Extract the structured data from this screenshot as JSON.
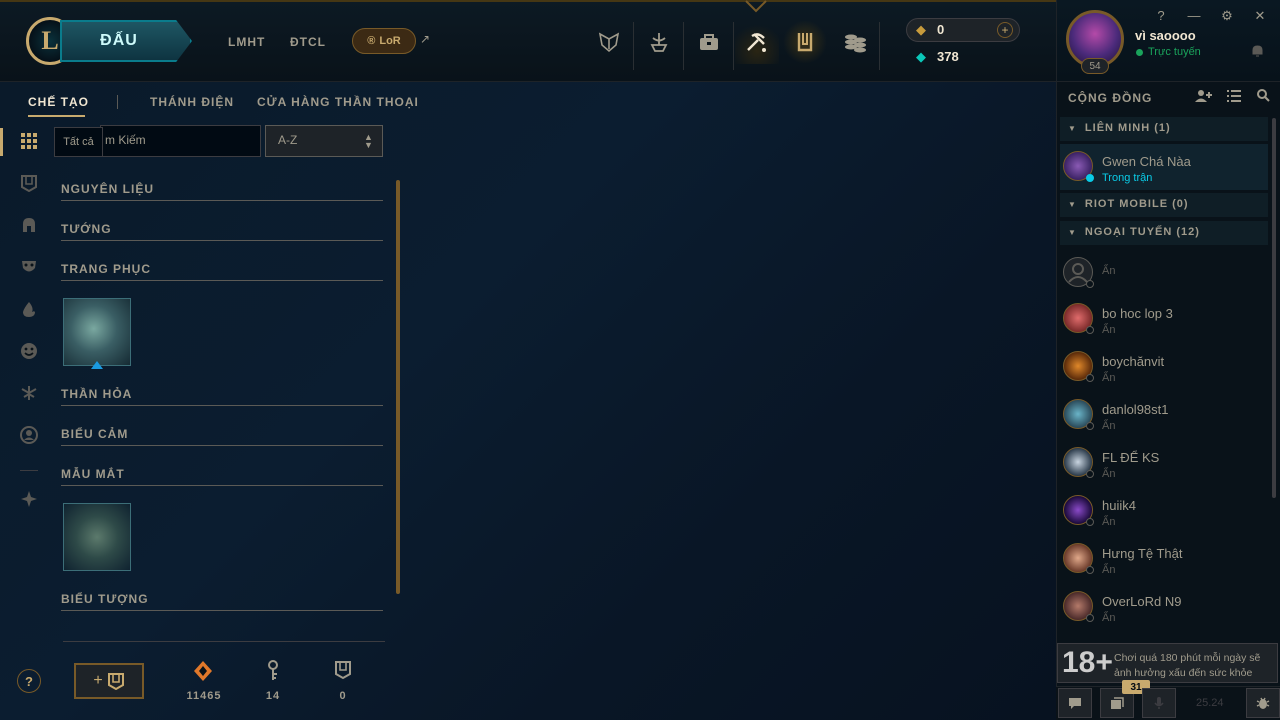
{
  "topbar": {
    "logo_letter": "L",
    "play_label": "ĐẤU",
    "nav_links": [
      "LMHT",
      "ĐTCL"
    ],
    "lor_label": "LoR",
    "ext_arrow": "↗",
    "icons": [
      "clash-icon",
      "ranked-icon",
      "collection-icon",
      "loot-icon",
      "store-icon",
      "currency-icon"
    ],
    "rp_value": "0",
    "be_value": "378"
  },
  "profile": {
    "name": "vì saoooo",
    "status": "Trực tuyến",
    "level": "54"
  },
  "window_controls": [
    "?",
    "—",
    "⚙",
    "✕"
  ],
  "tabs": [
    {
      "label": "CHẾ TẠO",
      "active": true
    },
    {
      "label": "THÁNH ĐIỆN",
      "active": false
    },
    {
      "label": "CỬA HÀNG THẦN THOẠI",
      "active": false
    }
  ],
  "filters": {
    "tooltip": "Tất cả",
    "search_text": "m Kiếm",
    "sort_value": "A-Z"
  },
  "sections": [
    "NGUYÊN LIỆU",
    "TƯỚNG",
    "TRANG PHỤC",
    "THẦN HỎA",
    "BIỂU CẢM",
    "MẪU MẮT",
    "BIỂU TƯỢNG"
  ],
  "bottom": {
    "help": "?",
    "craft_plus": "+",
    "loot_values": [
      "11465",
      "14",
      "0"
    ]
  },
  "social": {
    "header": "CỘNG ĐỒNG",
    "groups": [
      {
        "label": "LIÊN MINH (1)"
      },
      {
        "label": "RIOT MOBILE (0)"
      },
      {
        "label": "NGOẠI TUYẾN (12)"
      }
    ],
    "online_friend": {
      "name": "Gwen Chá Nàa",
      "status": "Trong trận"
    },
    "offline_friends": [
      {
        "name": "",
        "status": "Ẩn"
      },
      {
        "name": "bo hoc lop 3",
        "status": "Ẩn"
      },
      {
        "name": "boychănvit",
        "status": "Ẩn"
      },
      {
        "name": "danlol98st1",
        "status": "Ẩn"
      },
      {
        "name": "FL ĐỂ KS",
        "status": "Ẩn"
      },
      {
        "name": "huiik4",
        "status": "Ẩn"
      },
      {
        "name": "Hưng Tệ Thật",
        "status": "Ẩn"
      },
      {
        "name": "OverLoRd N9",
        "status": "Ẩn"
      }
    ]
  },
  "notice": {
    "age": "18+",
    "text": "Chơi quá 180 phút mỗi ngày sẽ ảnh hưởng xấu đến sức khỏe"
  },
  "footer": {
    "badge": "31",
    "version": "25.24"
  },
  "colors": {
    "gold": "#c8aa6e",
    "teal": "#0acbe6",
    "online_green": "#1aa35b"
  }
}
